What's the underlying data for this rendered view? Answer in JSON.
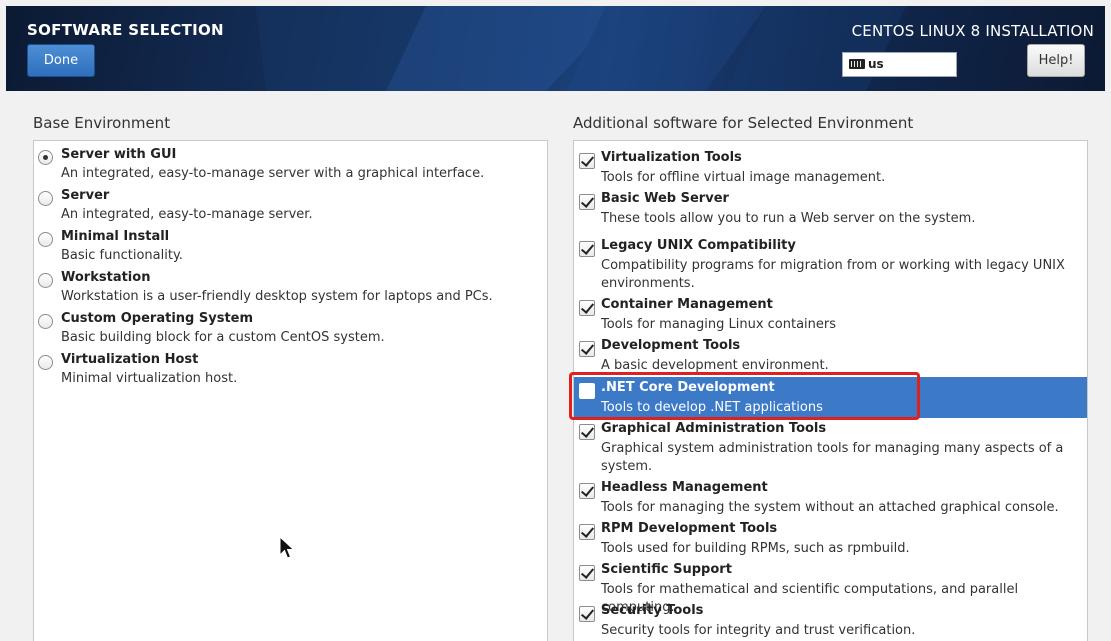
{
  "header": {
    "title": "SOFTWARE SELECTION",
    "done_label": "Done",
    "installation_title": "CENTOS LINUX 8 INSTALLATION",
    "keyboard_layout": "us",
    "help_label": "Help!"
  },
  "base_environment": {
    "label": "Base Environment",
    "items": [
      {
        "name": "Server with GUI",
        "desc": "An integrated, easy-to-manage server with a graphical interface.",
        "selected": true
      },
      {
        "name": "Server",
        "desc": "An integrated, easy-to-manage server.",
        "selected": false
      },
      {
        "name": "Minimal Install",
        "desc": "Basic functionality.",
        "selected": false
      },
      {
        "name": "Workstation",
        "desc": "Workstation is a user-friendly desktop system for laptops and PCs.",
        "selected": false
      },
      {
        "name": "Custom Operating System",
        "desc": "Basic building block for a custom CentOS system.",
        "selected": false
      },
      {
        "name": "Virtualization Host",
        "desc": "Minimal virtualization host.",
        "selected": false
      }
    ]
  },
  "additional_software": {
    "label": "Additional software for Selected Environment",
    "items": [
      {
        "name": "Virtualization Tools",
        "desc": "Tools for offline virtual image management.",
        "checked": true
      },
      {
        "name": "Basic Web Server",
        "desc": "These tools allow you to run a Web server on the system.",
        "checked": true
      },
      {
        "name": "Legacy UNIX Compatibility",
        "desc": "Compatibility programs for migration from or working with legacy UNIX environments.",
        "checked": true
      },
      {
        "name": "Container Management",
        "desc": "Tools for managing Linux containers",
        "checked": true
      },
      {
        "name": "Development Tools",
        "desc": "A basic development environment.",
        "checked": true
      },
      {
        "name": ".NET Core Development",
        "desc": "Tools to develop .NET applications",
        "checked": false,
        "highlighted": true
      },
      {
        "name": "Graphical Administration Tools",
        "desc": "Graphical system administration tools for managing many aspects of a system.",
        "checked": true
      },
      {
        "name": "Headless Management",
        "desc": "Tools for managing the system without an attached graphical console.",
        "checked": true
      },
      {
        "name": "RPM Development Tools",
        "desc": "Tools used for building RPMs, such as rpmbuild.",
        "checked": true
      },
      {
        "name": "Scientific Support",
        "desc": "Tools for mathematical and scientific computations, and parallel computing.",
        "checked": true
      },
      {
        "name": "Security Tools",
        "desc": "Security tools for integrity and trust verification.",
        "checked": true
      }
    ]
  },
  "colors": {
    "accent": "#3c79c6",
    "highlight_box": "#e02020"
  }
}
